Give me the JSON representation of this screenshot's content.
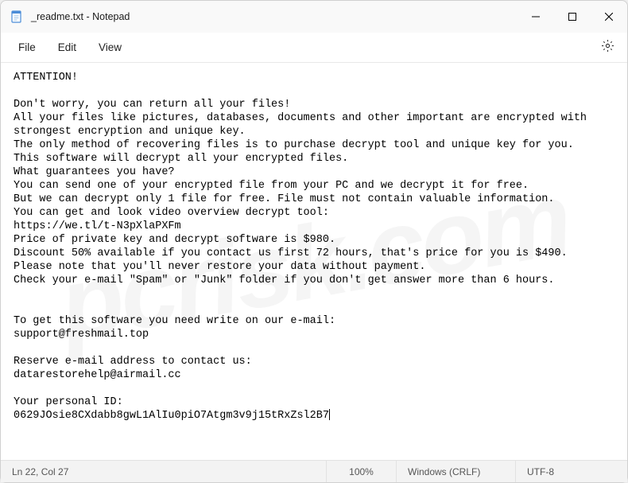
{
  "window": {
    "title": "_readme.txt - Notepad"
  },
  "menu": {
    "file": "File",
    "edit": "Edit",
    "view": "View"
  },
  "body": {
    "lines": [
      "ATTENTION!",
      "",
      "Don't worry, you can return all your files!",
      "All your files like pictures, databases, documents and other important are encrypted with",
      "strongest encryption and unique key.",
      "The only method of recovering files is to purchase decrypt tool and unique key for you.",
      "This software will decrypt all your encrypted files.",
      "What guarantees you have?",
      "You can send one of your encrypted file from your PC and we decrypt it for free.",
      "But we can decrypt only 1 file for free. File must not contain valuable information.",
      "You can get and look video overview decrypt tool:",
      "https://we.tl/t-N3pXlaPXFm",
      "Price of private key and decrypt software is $980.",
      "Discount 50% available if you contact us first 72 hours, that's price for you is $490.",
      "Please note that you'll never restore your data without payment.",
      "Check your e-mail \"Spam\" or \"Junk\" folder if you don't get answer more than 6 hours.",
      "",
      "",
      "To get this software you need write on our e-mail:",
      "support@freshmail.top",
      "",
      "Reserve e-mail address to contact us:",
      "datarestorehelp@airmail.cc",
      "",
      "Your personal ID:",
      "0629JOsie8CXdabb8gwL1AlIu0piO7Atgm3v9j15tRxZsl2B7"
    ]
  },
  "status": {
    "position": "Ln 22, Col 27",
    "zoom": "100%",
    "line_ending": "Windows (CRLF)",
    "encoding": "UTF-8"
  },
  "watermark": "pcrisk.com"
}
